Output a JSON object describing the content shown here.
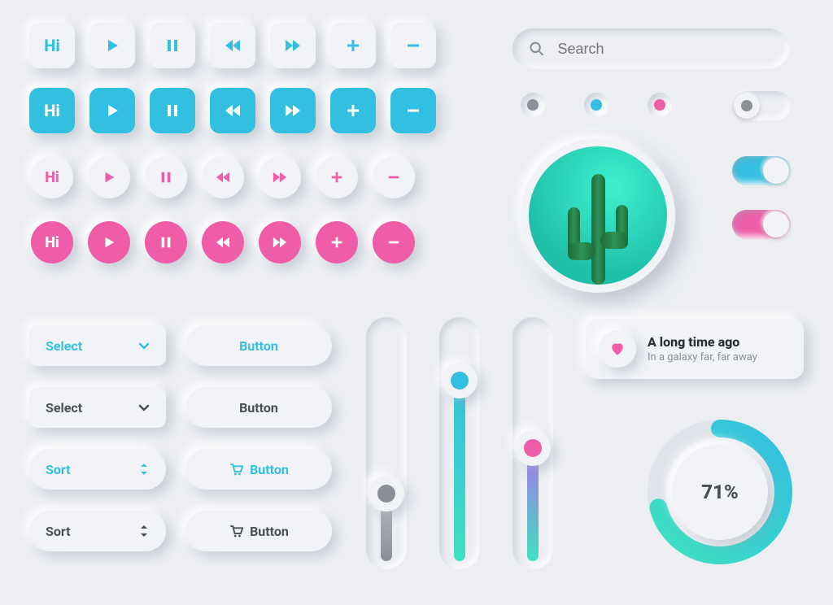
{
  "colors": {
    "cyan": "#33bfe0",
    "pink": "#ef5da8",
    "gray": "#8a8f98",
    "dark": "#4a4f57"
  },
  "hi_label": "Hi",
  "search": {
    "placeholder": "Search"
  },
  "radios": [
    {
      "color": "#8a8f98"
    },
    {
      "color": "#33bfe0"
    },
    {
      "color": "#ef5da8"
    }
  ],
  "toggles": {
    "off": {
      "on": false,
      "color": "#8a8f98"
    },
    "cyan": {
      "on": true,
      "color": "#33bfe0"
    },
    "pink": {
      "on": true,
      "color": "#ef5da8"
    }
  },
  "selects": [
    {
      "label": "Select",
      "style": "cyan",
      "icon": "chevron-down"
    },
    {
      "label": "Select",
      "style": "dark",
      "icon": "chevron-down"
    },
    {
      "label": "Sort",
      "style": "cyan",
      "icon": "sort"
    },
    {
      "label": "Sort",
      "style": "dark",
      "icon": "sort"
    }
  ],
  "buttons": [
    {
      "label": "Button",
      "style": "cyan",
      "icon": null
    },
    {
      "label": "Button",
      "style": "dark",
      "icon": null
    },
    {
      "label": "Button",
      "style": "cyan",
      "icon": "cart"
    },
    {
      "label": "Button",
      "style": "dark",
      "icon": "cart"
    }
  ],
  "sliders": [
    {
      "value": 30,
      "color": "#8a8f98",
      "gradient": [
        "#8a8f98",
        "#bfc3c9"
      ]
    },
    {
      "value": 75,
      "color": "#33bfe0",
      "gradient": [
        "#33bfe0",
        "#3fe0c0"
      ]
    },
    {
      "value": 48,
      "color": "#ef5da8",
      "gradient": [
        "#b16cef",
        "#3fe0c0"
      ]
    }
  ],
  "card": {
    "title": "A long time ago",
    "subtitle": "In a galaxy far, far away"
  },
  "progress": {
    "value": 71,
    "label": "71%"
  }
}
